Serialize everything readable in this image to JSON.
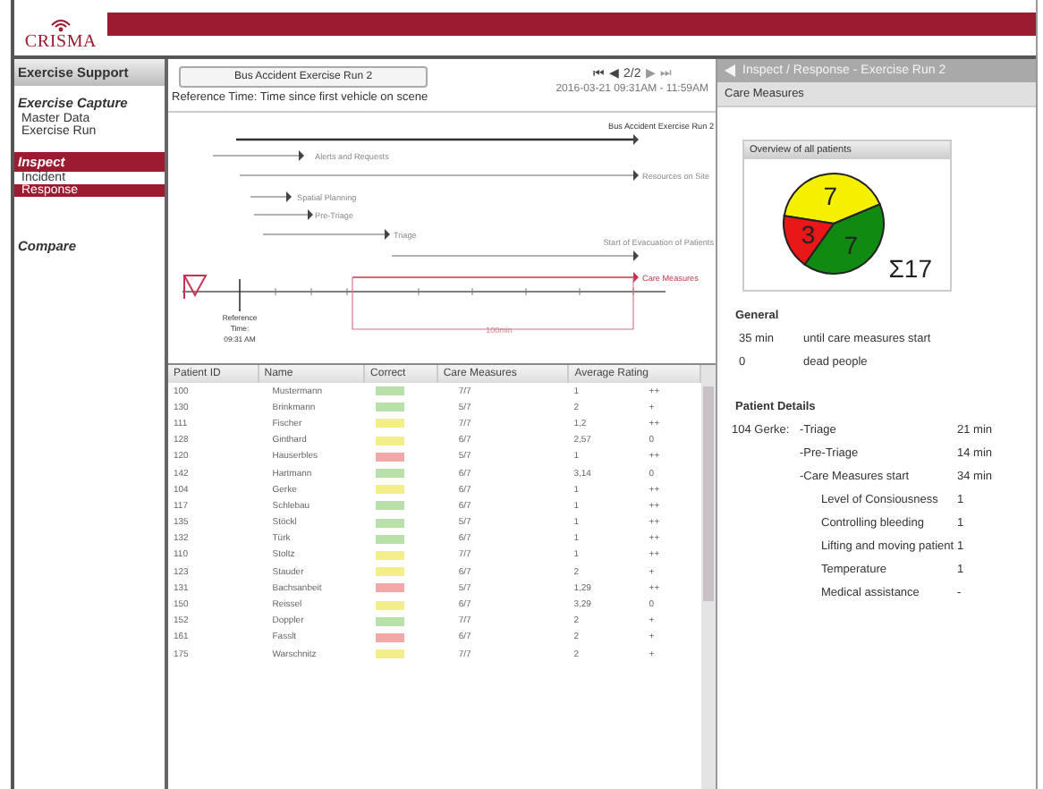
{
  "app": {
    "logo": "CRISMA"
  },
  "sidebar": {
    "title": "Exercise Support",
    "sections": [
      {
        "label": "Exercise Capture",
        "active": false,
        "items": [
          {
            "label": "Master Data",
            "selected": false
          },
          {
            "label": "Exercise Run",
            "selected": false
          }
        ]
      },
      {
        "label": "Inspect",
        "active": true,
        "items": [
          {
            "label": "Incident",
            "selected": false
          },
          {
            "label": "Response",
            "selected": true
          }
        ]
      },
      {
        "label": "Compare",
        "active": false
      }
    ]
  },
  "toolbar": {
    "run_button": "Bus Accident Exercise Run 2",
    "nav": {
      "first": "⏮",
      "prev": "◀",
      "page": "2/2",
      "next": "▶",
      "last": "⏭"
    },
    "reference_time": "Reference Time: Time since first vehicle on scene",
    "date_range": "2016-03-21  09:31AM - 11:59AM"
  },
  "timeline": {
    "items": [
      {
        "label": "Bus Accident Exercise Run 2",
        "kind": "normal"
      },
      {
        "label": "Alerts and Requests",
        "kind": "normal"
      },
      {
        "label": "Resources on Site",
        "kind": "normal"
      },
      {
        "label": "Spatial Planning",
        "kind": "normal"
      },
      {
        "label": "Pre-Triage",
        "kind": "normal"
      },
      {
        "label": "Triage",
        "kind": "normal"
      },
      {
        "label": "Start of Evacuation of Patients",
        "kind": "normal"
      },
      {
        "label": "Care Measures",
        "kind": "highlight"
      }
    ],
    "reference_lines": [
      "Reference",
      "Time:",
      "09:31 AM"
    ],
    "span": "100min"
  },
  "table": {
    "columns": [
      "Patient ID",
      "Name",
      "Correct",
      "Care Measures",
      "Average Rating"
    ],
    "rows": [
      {
        "id": "100",
        "name": "Mustermann",
        "color": "#b8e0a8",
        "care": "7/7",
        "avg": "1",
        "rating": "++"
      },
      {
        "id": "130",
        "name": "Brinkmann",
        "color": "#b8e0a8",
        "care": "5/7",
        "avg": "2",
        "rating": "+"
      },
      {
        "id": "111",
        "name": "Fischer",
        "color": "#f3ee8a",
        "care": "7/7",
        "avg": "1,2",
        "rating": "++"
      },
      {
        "id": "128",
        "name": "Ginthard",
        "color": "#f3ee8a",
        "care": "6/7",
        "avg": "2,57",
        "rating": "0"
      },
      {
        "id": "120",
        "name": "Hauserbles",
        "color": "#f0a8a8",
        "care": "5/7",
        "avg": "1",
        "rating": "++"
      },
      {
        "id": "142",
        "name": "Hartmann",
        "color": "#b8e0a8",
        "care": "6/7",
        "avg": "3,14",
        "rating": "0"
      },
      {
        "id": "104",
        "name": "Gerke",
        "color": "#f3ee8a",
        "care": "6/7",
        "avg": "1",
        "rating": "++"
      },
      {
        "id": "117",
        "name": "Schlebau",
        "color": "#b8e0a8",
        "care": "6/7",
        "avg": "1",
        "rating": "++"
      },
      {
        "id": "135",
        "name": "Stöckl",
        "color": "#b8e0a8",
        "care": "5/7",
        "avg": "1",
        "rating": "++"
      },
      {
        "id": "132",
        "name": "Türk",
        "color": "#b8e0a8",
        "care": "6/7",
        "avg": "1",
        "rating": "++"
      },
      {
        "id": "110",
        "name": "Stoltz",
        "color": "#f3ee8a",
        "care": "7/7",
        "avg": "1",
        "rating": "++"
      },
      {
        "id": "123",
        "name": "Stauder",
        "color": "#f3ee8a",
        "care": "6/7",
        "avg": "2",
        "rating": "+"
      },
      {
        "id": "131",
        "name": "Bachsanbeit",
        "color": "#f0a8a8",
        "care": "5/7",
        "avg": "1,29",
        "rating": "++"
      },
      {
        "id": "150",
        "name": "Reissel",
        "color": "#f3ee8a",
        "care": "6/7",
        "avg": "3,29",
        "rating": "0"
      },
      {
        "id": "152",
        "name": "Doppler",
        "color": "#b8e0a8",
        "care": "7/7",
        "avg": "2",
        "rating": "+"
      },
      {
        "id": "161",
        "name": "Fasslt",
        "color": "#f0a8a8",
        "care": "6/7",
        "avg": "2",
        "rating": "+"
      },
      {
        "id": "175",
        "name": "Warschnitz",
        "color": "#f3ee8a",
        "care": "7/7",
        "avg": "2",
        "rating": "+"
      }
    ]
  },
  "detail_panel": {
    "breadcrumb": "Inspect / Response - Exercise Run 2",
    "title": "Care Measures",
    "overview": {
      "title": "Overview of all patients",
      "total": "Σ17",
      "chart_data": {
        "type": "pie",
        "values": [
          7,
          7,
          3
        ],
        "colors": [
          "#f5f000",
          "#118a11",
          "#e81818"
        ],
        "data_labels": true
      }
    },
    "general": {
      "title": "General",
      "rows": [
        {
          "value": "35 min",
          "label": "until care measures start"
        },
        {
          "value": "0",
          "label": "dead people"
        }
      ]
    },
    "patient_details": {
      "title": "Patient Details",
      "patient": "104 Gerke:",
      "phases": [
        {
          "label": "-Triage",
          "value": "21 min"
        },
        {
          "label": "-Pre-Triage",
          "value": "14 min"
        },
        {
          "label": "-Care Measures start",
          "value": "34 min"
        }
      ],
      "measures": [
        {
          "label": "Level of Consiousness",
          "value": "1"
        },
        {
          "label": "Controlling bleeding",
          "value": "1"
        },
        {
          "label": "Lifting and moving patient",
          "value": "1"
        },
        {
          "label": "Temperature",
          "value": "1"
        },
        {
          "label": "Medical assistance",
          "value": "-"
        }
      ]
    }
  }
}
